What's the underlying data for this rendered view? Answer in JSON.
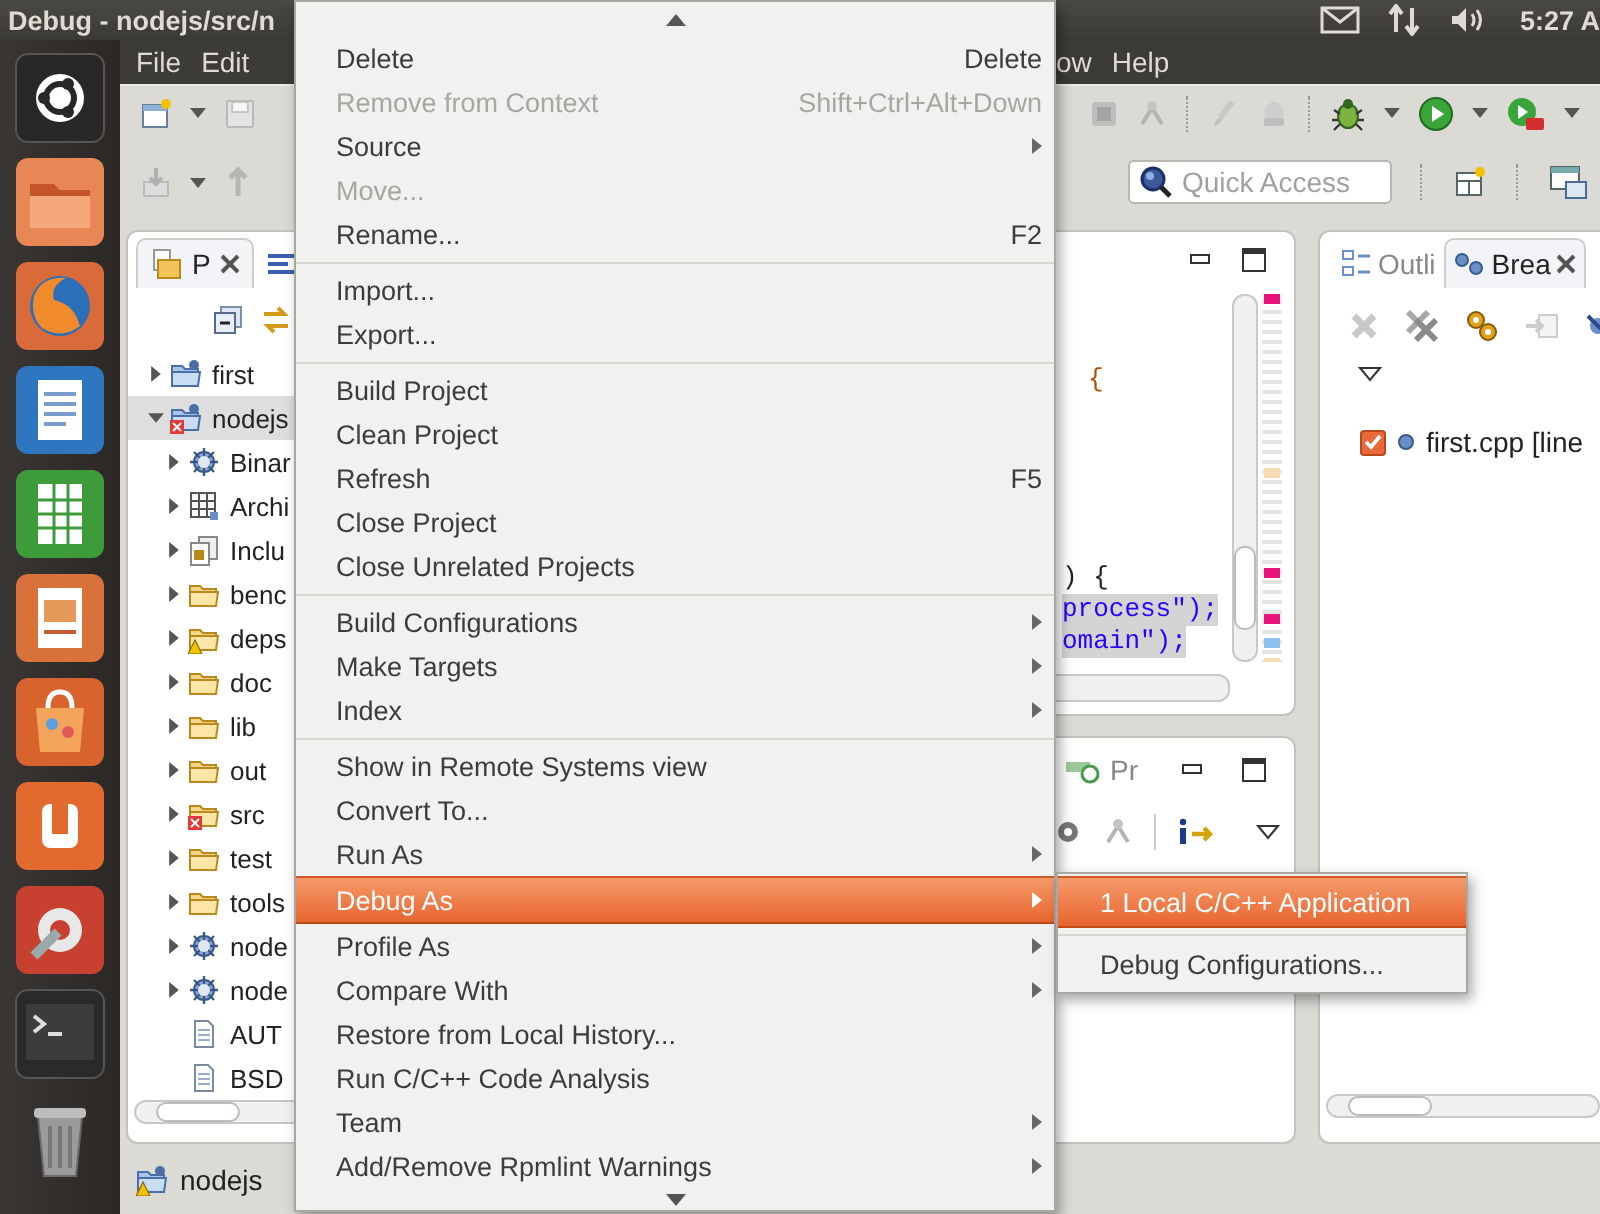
{
  "top_bar": {
    "title": "Debug - nodejs/src/n",
    "clock": "5:27 A"
  },
  "menubar": [
    "File",
    "Edit",
    "ow",
    "Help"
  ],
  "quick_access": {
    "placeholder": "Quick Access"
  },
  "project_explorer": {
    "tabs": [
      {
        "label": "P",
        "selected": true
      }
    ],
    "tree": [
      {
        "label": "first",
        "kind": "project",
        "error": false,
        "warning": false,
        "expanded": false,
        "selected": false
      },
      {
        "label": "nodejs",
        "kind": "project",
        "error": true,
        "warning": false,
        "expanded": true,
        "selected": true,
        "children": [
          {
            "label": "Binar",
            "kind": "binaries",
            "error": false,
            "warning": false,
            "expanded": false,
            "selected": false
          },
          {
            "label": "Archi",
            "kind": "archives",
            "error": false,
            "warning": false,
            "expanded": false,
            "selected": false
          },
          {
            "label": "Inclu",
            "kind": "includes",
            "error": false,
            "warning": false,
            "expanded": false,
            "selected": false
          },
          {
            "label": "benc",
            "kind": "folder",
            "error": false,
            "warning": false,
            "expanded": false,
            "selected": false
          },
          {
            "label": "deps",
            "kind": "folder",
            "error": false,
            "warning": true,
            "expanded": false,
            "selected": false
          },
          {
            "label": "doc",
            "kind": "folder",
            "error": false,
            "warning": false,
            "expanded": false,
            "selected": false
          },
          {
            "label": "lib",
            "kind": "folder",
            "error": false,
            "warning": false,
            "expanded": false,
            "selected": false
          },
          {
            "label": "out",
            "kind": "folder",
            "error": false,
            "warning": false,
            "expanded": false,
            "selected": false
          },
          {
            "label": "src",
            "kind": "folder",
            "error": true,
            "warning": false,
            "expanded": false,
            "selected": false
          },
          {
            "label": "test",
            "kind": "folder",
            "error": false,
            "warning": false,
            "expanded": false,
            "selected": false
          },
          {
            "label": "tools",
            "kind": "folder",
            "error": false,
            "warning": false,
            "expanded": false,
            "selected": false
          },
          {
            "label": "node",
            "kind": "executable",
            "error": false,
            "warning": false,
            "expanded": false,
            "selected": false
          },
          {
            "label": "node",
            "kind": "executable",
            "error": false,
            "warning": false,
            "expanded": false,
            "selected": false
          },
          {
            "label": "AUT",
            "kind": "file",
            "error": false,
            "warning": false,
            "selected": false
          },
          {
            "label": "BSD",
            "kind": "file",
            "error": false,
            "warning": false,
            "selected": false
          }
        ]
      }
    ]
  },
  "editor": {
    "code_lines": [
      {
        "text": "{",
        "highlighted": false
      },
      {
        "text": ") {",
        "highlighted": false
      },
      {
        "text": "process\");",
        "highlighted": true
      },
      {
        "text": "omain\");",
        "highlighted": true
      }
    ]
  },
  "bottom_panel": {
    "tabs": [
      {
        "label": "Pr",
        "selected": false
      }
    ]
  },
  "right_panel": {
    "tabs": [
      {
        "label": "Outli",
        "selected": false
      },
      {
        "label": "Brea",
        "selected": true
      }
    ],
    "breakpoints": [
      {
        "label": "first.cpp [line",
        "checked": true
      }
    ]
  },
  "status_bar": {
    "label": "nodejs"
  },
  "context_menu": {
    "items": [
      {
        "kind": "item",
        "label": "Delete",
        "shortcut": "Delete",
        "submenu": false,
        "disabled": false,
        "selected": false
      },
      {
        "kind": "item",
        "label": "Remove from Context",
        "shortcut": "Shift+Ctrl+Alt+Down",
        "submenu": false,
        "disabled": true,
        "selected": false
      },
      {
        "kind": "item",
        "label": "Source",
        "submenu": true,
        "disabled": false,
        "selected": false
      },
      {
        "kind": "item",
        "label": "Move...",
        "submenu": false,
        "disabled": true,
        "selected": false
      },
      {
        "kind": "item",
        "label": "Rename...",
        "shortcut": "F2",
        "submenu": false,
        "disabled": false,
        "selected": false
      },
      {
        "kind": "separator"
      },
      {
        "kind": "item",
        "label": "Import...",
        "submenu": false,
        "disabled": false,
        "selected": false
      },
      {
        "kind": "item",
        "label": "Export...",
        "submenu": false,
        "disabled": false,
        "selected": false
      },
      {
        "kind": "separator"
      },
      {
        "kind": "item",
        "label": "Build Project",
        "submenu": false,
        "disabled": false,
        "selected": false
      },
      {
        "kind": "item",
        "label": "Clean Project",
        "submenu": false,
        "disabled": false,
        "selected": false
      },
      {
        "kind": "item",
        "label": "Refresh",
        "shortcut": "F5",
        "submenu": false,
        "disabled": false,
        "selected": false
      },
      {
        "kind": "item",
        "label": "Close Project",
        "submenu": false,
        "disabled": false,
        "selected": false
      },
      {
        "kind": "item",
        "label": "Close Unrelated Projects",
        "submenu": false,
        "disabled": false,
        "selected": false
      },
      {
        "kind": "separator"
      },
      {
        "kind": "item",
        "label": "Build Configurations",
        "submenu": true,
        "disabled": false,
        "selected": false
      },
      {
        "kind": "item",
        "label": "Make Targets",
        "submenu": true,
        "disabled": false,
        "selected": false
      },
      {
        "kind": "item",
        "label": "Index",
        "submenu": true,
        "disabled": false,
        "selected": false
      },
      {
        "kind": "separator"
      },
      {
        "kind": "item",
        "label": "Show in Remote Systems view",
        "submenu": false,
        "disabled": false,
        "selected": false
      },
      {
        "kind": "item",
        "label": "Convert To...",
        "submenu": false,
        "disabled": false,
        "selected": false
      },
      {
        "kind": "item",
        "label": "Run As",
        "submenu": true,
        "disabled": false,
        "selected": false
      },
      {
        "kind": "item",
        "label": "Debug As",
        "submenu": true,
        "disabled": false,
        "selected": true
      },
      {
        "kind": "item",
        "label": "Profile As",
        "submenu": true,
        "disabled": false,
        "selected": false
      },
      {
        "kind": "item",
        "label": "Compare With",
        "submenu": true,
        "disabled": false,
        "selected": false
      },
      {
        "kind": "item",
        "label": "Restore from Local History...",
        "submenu": false,
        "disabled": false,
        "selected": false
      },
      {
        "kind": "item",
        "label": "Run C/C++ Code Analysis",
        "submenu": false,
        "disabled": false,
        "selected": false
      },
      {
        "kind": "item",
        "label": "Team",
        "submenu": true,
        "disabled": false,
        "selected": false
      },
      {
        "kind": "item",
        "label": "Add/Remove Rpmlint Warnings",
        "submenu": true,
        "disabled": false,
        "selected": false
      }
    ]
  },
  "submenu": {
    "items": [
      {
        "kind": "item",
        "label": "1 Local C/C++ Application",
        "submenu": false,
        "disabled": false,
        "selected": true
      },
      {
        "kind": "separator"
      },
      {
        "kind": "item",
        "label": "Debug Configurations...",
        "submenu": false,
        "disabled": false,
        "selected": false
      }
    ]
  }
}
